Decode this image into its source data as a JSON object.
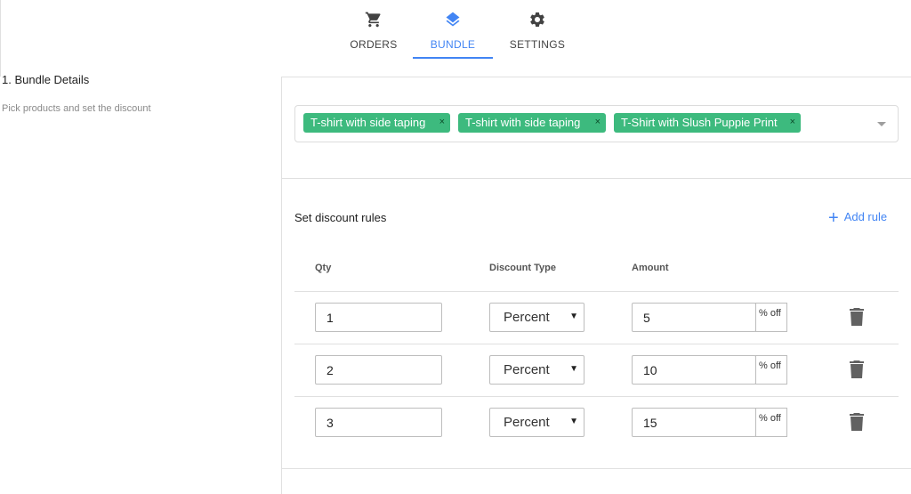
{
  "tabs": [
    {
      "label": "ORDERS",
      "icon": "cart-icon"
    },
    {
      "label": "BUNDLE",
      "icon": "layers-icon",
      "active": true
    },
    {
      "label": "SETTINGS",
      "icon": "gear-icon"
    }
  ],
  "bundle_details": {
    "title": "1. Bundle Details",
    "subtitle": "Pick products and set the discount"
  },
  "products": {
    "selected": [
      "T-shirt with side taping",
      "T-shirt with side taping",
      "T-Shirt with Slush Puppie Print"
    ],
    "remove_glyph": "×"
  },
  "discount_rules": {
    "title": "Set discount rules",
    "add_rule_label": "Add rule",
    "columns": {
      "qty": "Qty",
      "type": "Discount Type",
      "amount": "Amount"
    },
    "rows": [
      {
        "qty": "1",
        "type": "Percent",
        "amount": "5",
        "suffix": "% off"
      },
      {
        "qty": "2",
        "type": "Percent",
        "amount": "10",
        "suffix": "% off"
      },
      {
        "qty": "3",
        "type": "Percent",
        "amount": "15",
        "suffix": "% off"
      }
    ]
  },
  "colors": {
    "accent": "#4285f4",
    "chip": "#3dba7e"
  }
}
